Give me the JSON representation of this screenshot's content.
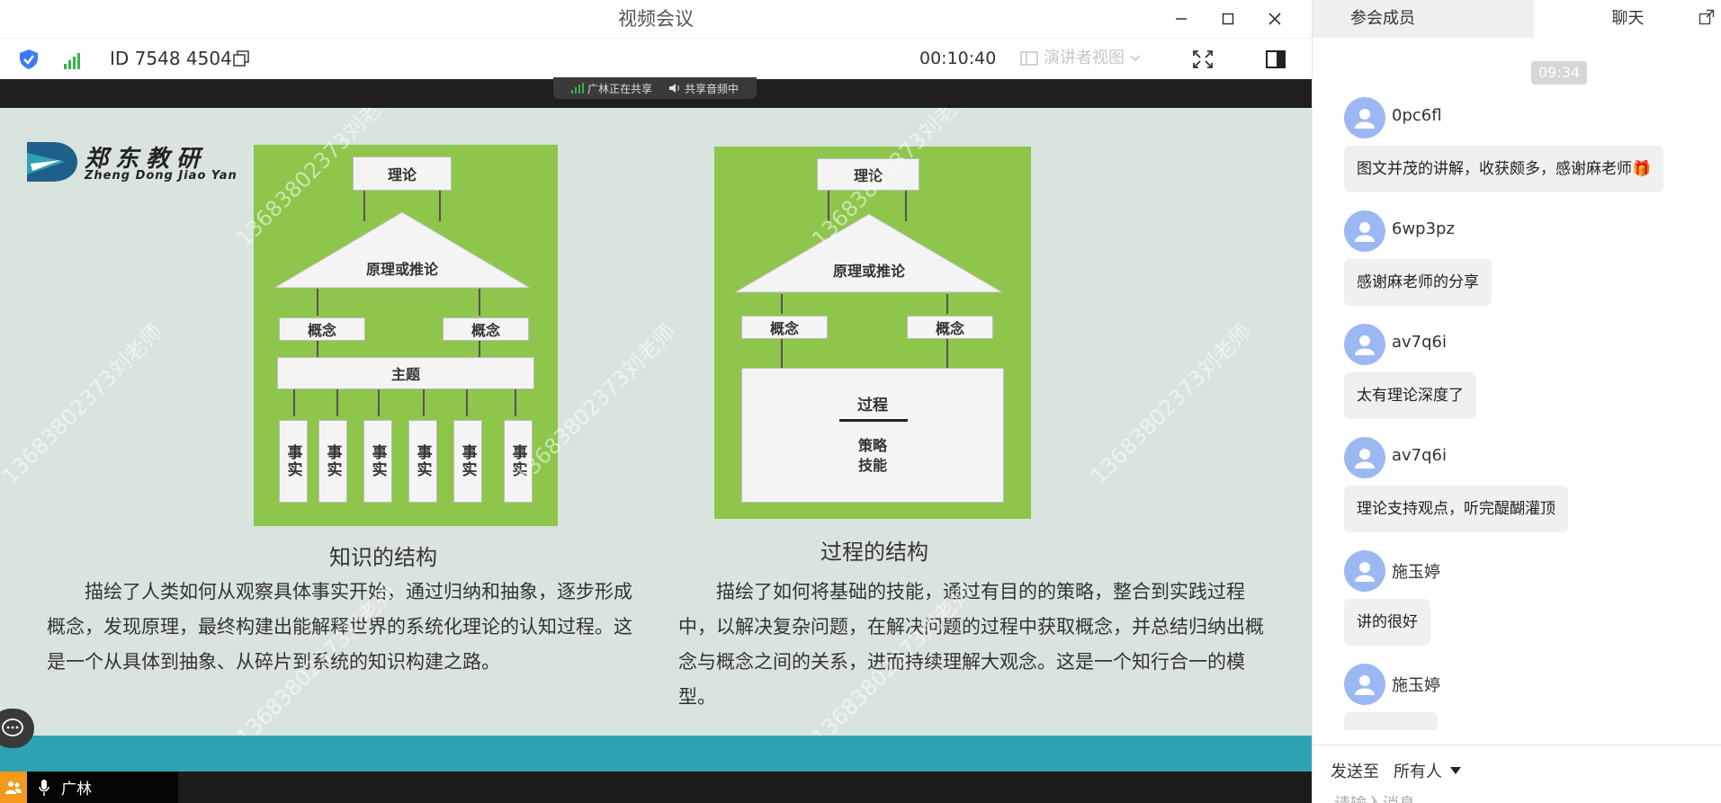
{
  "window": {
    "title": "视频会议"
  },
  "toolbar": {
    "meeting_id": "ID 7548 4504",
    "timer": "00:10:40",
    "speaker_view": "演讲者视图"
  },
  "share": {
    "sharing": "广林正在共享",
    "audio": "共享音频中"
  },
  "slide": {
    "logo_cn": "郑东教研",
    "logo_en": "Zheng Dong Jiao Yan",
    "left": {
      "top": "理论",
      "triangle": "原理或推论",
      "concept_a": "概念",
      "concept_b": "概念",
      "theme": "主题",
      "facts": [
        "事实",
        "事实",
        "事实",
        "事实",
        "事实",
        "事实"
      ],
      "caption": "知识的结构",
      "text": "描绘了人类如何从观察具体事实开始，通过归纳和抽象，逐步形成概念，发现原理，最终构建出能解释世界的系统化理论的认知过程。这是一个从具体到抽象、从碎片到系统的知识构建之路。"
    },
    "right": {
      "top": "理论",
      "triangle": "原理或推论",
      "concept_a": "概念",
      "concept_b": "概念",
      "process": "过程",
      "strategy": "策略",
      "skill": "技能",
      "caption": "过程的结构",
      "text": "描绘了如何将基础的技能，通过有目的的策略，整合到实践过程中，以解决复杂问题，在解决问题的过程中获取概念，并总结归纳出概念与概念之间的关系，进而持续理解大观念。这是一个知行合一的模型。"
    },
    "watermark": "13683802373刘老师"
  },
  "footer": {
    "user": "广林"
  },
  "panel": {
    "tab_members": "参会成员",
    "tab_chat": "聊天",
    "timestamp": "09:34",
    "messages": [
      {
        "user": "0pc6fl",
        "text": "图文并茂的讲解，收获颇多，感谢麻老师🎁"
      },
      {
        "user": "6wp3pz",
        "text": "感谢麻老师的分享"
      },
      {
        "user": "av7q6i",
        "text": "太有理论深度了"
      },
      {
        "user": "av7q6i",
        "text": "理论支持观点，听完醍醐灌顶"
      },
      {
        "user": "施玉婷",
        "text": "讲的很好"
      },
      {
        "user": "施玉婷",
        "text": ""
      }
    ],
    "send_to_label": "发送至",
    "send_to_value": "所有人",
    "input_placeholder": "请输入消息"
  }
}
